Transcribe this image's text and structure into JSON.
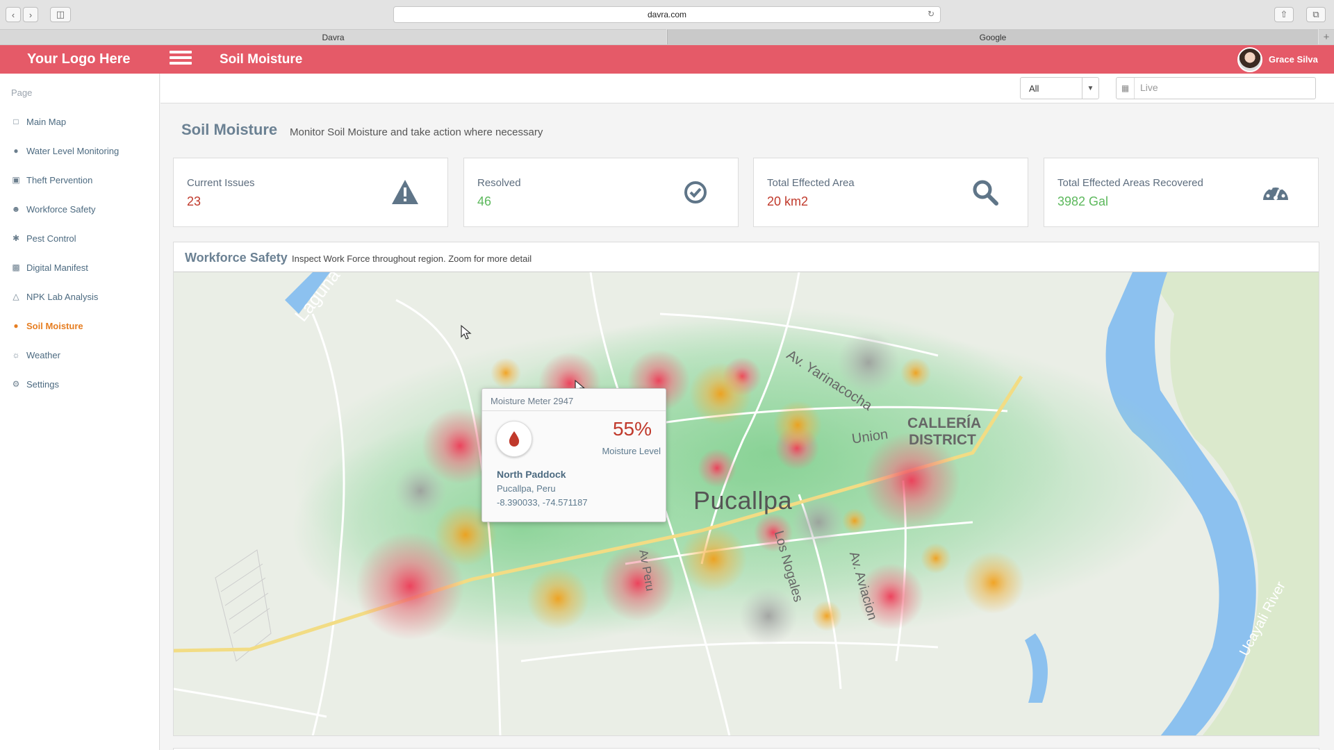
{
  "browser": {
    "url": "davra.com",
    "tabs": [
      {
        "label": "Davra",
        "active": true
      },
      {
        "label": "Google",
        "active": false
      }
    ]
  },
  "header": {
    "logo": "Your Logo Here",
    "title": "Soil Moisture",
    "user_name": "Grace Silva",
    "brand_color": "#e55a68"
  },
  "sidebar": {
    "heading": "Page",
    "items": [
      {
        "label": "Main Map",
        "icon": "map-icon"
      },
      {
        "label": "Water Level Monitoring",
        "icon": "droplet-icon"
      },
      {
        "label": "Theft Pervention",
        "icon": "lock-icon"
      },
      {
        "label": "Workforce Safety",
        "icon": "users-icon"
      },
      {
        "label": "Pest Control",
        "icon": "bug-icon"
      },
      {
        "label": "Digital Manifest",
        "icon": "truck-icon"
      },
      {
        "label": "NPK Lab Analysis",
        "icon": "flask-icon"
      },
      {
        "label": "Soil Moisture",
        "icon": "droplet-icon",
        "active": true
      },
      {
        "label": "Weather",
        "icon": "sun-icon"
      },
      {
        "label": "Settings",
        "icon": "gear-icon"
      }
    ]
  },
  "toolbar": {
    "filter_value": "All",
    "date_placeholder": "Live"
  },
  "page": {
    "title": "Soil Moisture",
    "subtitle": "Monitor Soil Moisture and take action where necessary"
  },
  "cards": [
    {
      "label": "Current Issues",
      "value": "23",
      "value_color": "#c0392b",
      "icon": "warning-icon"
    },
    {
      "label": "Resolved",
      "value": "46",
      "value_color": "#5cb85c",
      "icon": "check-circle-icon"
    },
    {
      "label": "Total Effected Area",
      "value": "20 km2",
      "value_color": "#c0392b",
      "icon": "search-icon"
    },
    {
      "label": "Total Effected Areas Recovered",
      "value": "3982 Gal",
      "value_color": "#5cb85c",
      "icon": "dashboard-icon"
    }
  ],
  "map_panel": {
    "title": "Workforce Safety",
    "subtitle": "Inspect Work Force throughout region. Zoom for more detail",
    "labels": {
      "city": "Pucallpa",
      "district_line1": "CALLERÍA",
      "district_line2": "DISTRICT",
      "union": "Union",
      "av_yarinacocha": "Av. Yarinacocha",
      "laguna": "Laguna",
      "los_nogales": "Los Nogales",
      "av_aviacion": "Av. Aviacion",
      "av_peru": "Av Peru",
      "river": "Ucayali River"
    }
  },
  "popup": {
    "title": "Moisture Meter 2947",
    "percent": "55%",
    "metric_label": "Moisture Level",
    "location_name": "North Paddock",
    "city": "Pucallpa, Peru",
    "coords": "-8.390033, -74.571187"
  }
}
